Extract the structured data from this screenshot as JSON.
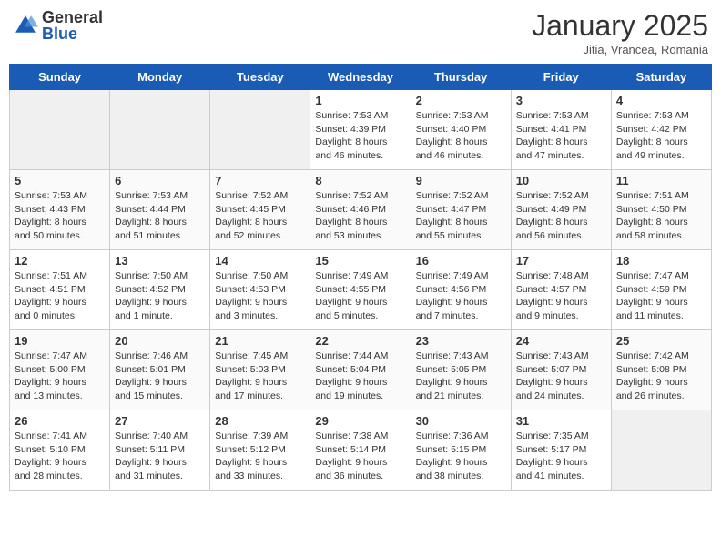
{
  "logo": {
    "general": "General",
    "blue": "Blue"
  },
  "title": "January 2025",
  "subtitle": "Jitia, Vrancea, Romania",
  "headers": [
    "Sunday",
    "Monday",
    "Tuesday",
    "Wednesday",
    "Thursday",
    "Friday",
    "Saturday"
  ],
  "weeks": [
    [
      {
        "day": "",
        "info": ""
      },
      {
        "day": "",
        "info": ""
      },
      {
        "day": "",
        "info": ""
      },
      {
        "day": "1",
        "info": "Sunrise: 7:53 AM\nSunset: 4:39 PM\nDaylight: 8 hours\nand 46 minutes."
      },
      {
        "day": "2",
        "info": "Sunrise: 7:53 AM\nSunset: 4:40 PM\nDaylight: 8 hours\nand 46 minutes."
      },
      {
        "day": "3",
        "info": "Sunrise: 7:53 AM\nSunset: 4:41 PM\nDaylight: 8 hours\nand 47 minutes."
      },
      {
        "day": "4",
        "info": "Sunrise: 7:53 AM\nSunset: 4:42 PM\nDaylight: 8 hours\nand 49 minutes."
      }
    ],
    [
      {
        "day": "5",
        "info": "Sunrise: 7:53 AM\nSunset: 4:43 PM\nDaylight: 8 hours\nand 50 minutes."
      },
      {
        "day": "6",
        "info": "Sunrise: 7:53 AM\nSunset: 4:44 PM\nDaylight: 8 hours\nand 51 minutes."
      },
      {
        "day": "7",
        "info": "Sunrise: 7:52 AM\nSunset: 4:45 PM\nDaylight: 8 hours\nand 52 minutes."
      },
      {
        "day": "8",
        "info": "Sunrise: 7:52 AM\nSunset: 4:46 PM\nDaylight: 8 hours\nand 53 minutes."
      },
      {
        "day": "9",
        "info": "Sunrise: 7:52 AM\nSunset: 4:47 PM\nDaylight: 8 hours\nand 55 minutes."
      },
      {
        "day": "10",
        "info": "Sunrise: 7:52 AM\nSunset: 4:49 PM\nDaylight: 8 hours\nand 56 minutes."
      },
      {
        "day": "11",
        "info": "Sunrise: 7:51 AM\nSunset: 4:50 PM\nDaylight: 8 hours\nand 58 minutes."
      }
    ],
    [
      {
        "day": "12",
        "info": "Sunrise: 7:51 AM\nSunset: 4:51 PM\nDaylight: 9 hours\nand 0 minutes."
      },
      {
        "day": "13",
        "info": "Sunrise: 7:50 AM\nSunset: 4:52 PM\nDaylight: 9 hours\nand 1 minute."
      },
      {
        "day": "14",
        "info": "Sunrise: 7:50 AM\nSunset: 4:53 PM\nDaylight: 9 hours\nand 3 minutes."
      },
      {
        "day": "15",
        "info": "Sunrise: 7:49 AM\nSunset: 4:55 PM\nDaylight: 9 hours\nand 5 minutes."
      },
      {
        "day": "16",
        "info": "Sunrise: 7:49 AM\nSunset: 4:56 PM\nDaylight: 9 hours\nand 7 minutes."
      },
      {
        "day": "17",
        "info": "Sunrise: 7:48 AM\nSunset: 4:57 PM\nDaylight: 9 hours\nand 9 minutes."
      },
      {
        "day": "18",
        "info": "Sunrise: 7:47 AM\nSunset: 4:59 PM\nDaylight: 9 hours\nand 11 minutes."
      }
    ],
    [
      {
        "day": "19",
        "info": "Sunrise: 7:47 AM\nSunset: 5:00 PM\nDaylight: 9 hours\nand 13 minutes."
      },
      {
        "day": "20",
        "info": "Sunrise: 7:46 AM\nSunset: 5:01 PM\nDaylight: 9 hours\nand 15 minutes."
      },
      {
        "day": "21",
        "info": "Sunrise: 7:45 AM\nSunset: 5:03 PM\nDaylight: 9 hours\nand 17 minutes."
      },
      {
        "day": "22",
        "info": "Sunrise: 7:44 AM\nSunset: 5:04 PM\nDaylight: 9 hours\nand 19 minutes."
      },
      {
        "day": "23",
        "info": "Sunrise: 7:43 AM\nSunset: 5:05 PM\nDaylight: 9 hours\nand 21 minutes."
      },
      {
        "day": "24",
        "info": "Sunrise: 7:43 AM\nSunset: 5:07 PM\nDaylight: 9 hours\nand 24 minutes."
      },
      {
        "day": "25",
        "info": "Sunrise: 7:42 AM\nSunset: 5:08 PM\nDaylight: 9 hours\nand 26 minutes."
      }
    ],
    [
      {
        "day": "26",
        "info": "Sunrise: 7:41 AM\nSunset: 5:10 PM\nDaylight: 9 hours\nand 28 minutes."
      },
      {
        "day": "27",
        "info": "Sunrise: 7:40 AM\nSunset: 5:11 PM\nDaylight: 9 hours\nand 31 minutes."
      },
      {
        "day": "28",
        "info": "Sunrise: 7:39 AM\nSunset: 5:12 PM\nDaylight: 9 hours\nand 33 minutes."
      },
      {
        "day": "29",
        "info": "Sunrise: 7:38 AM\nSunset: 5:14 PM\nDaylight: 9 hours\nand 36 minutes."
      },
      {
        "day": "30",
        "info": "Sunrise: 7:36 AM\nSunset: 5:15 PM\nDaylight: 9 hours\nand 38 minutes."
      },
      {
        "day": "31",
        "info": "Sunrise: 7:35 AM\nSunset: 5:17 PM\nDaylight: 9 hours\nand 41 minutes."
      },
      {
        "day": "",
        "info": ""
      }
    ]
  ]
}
